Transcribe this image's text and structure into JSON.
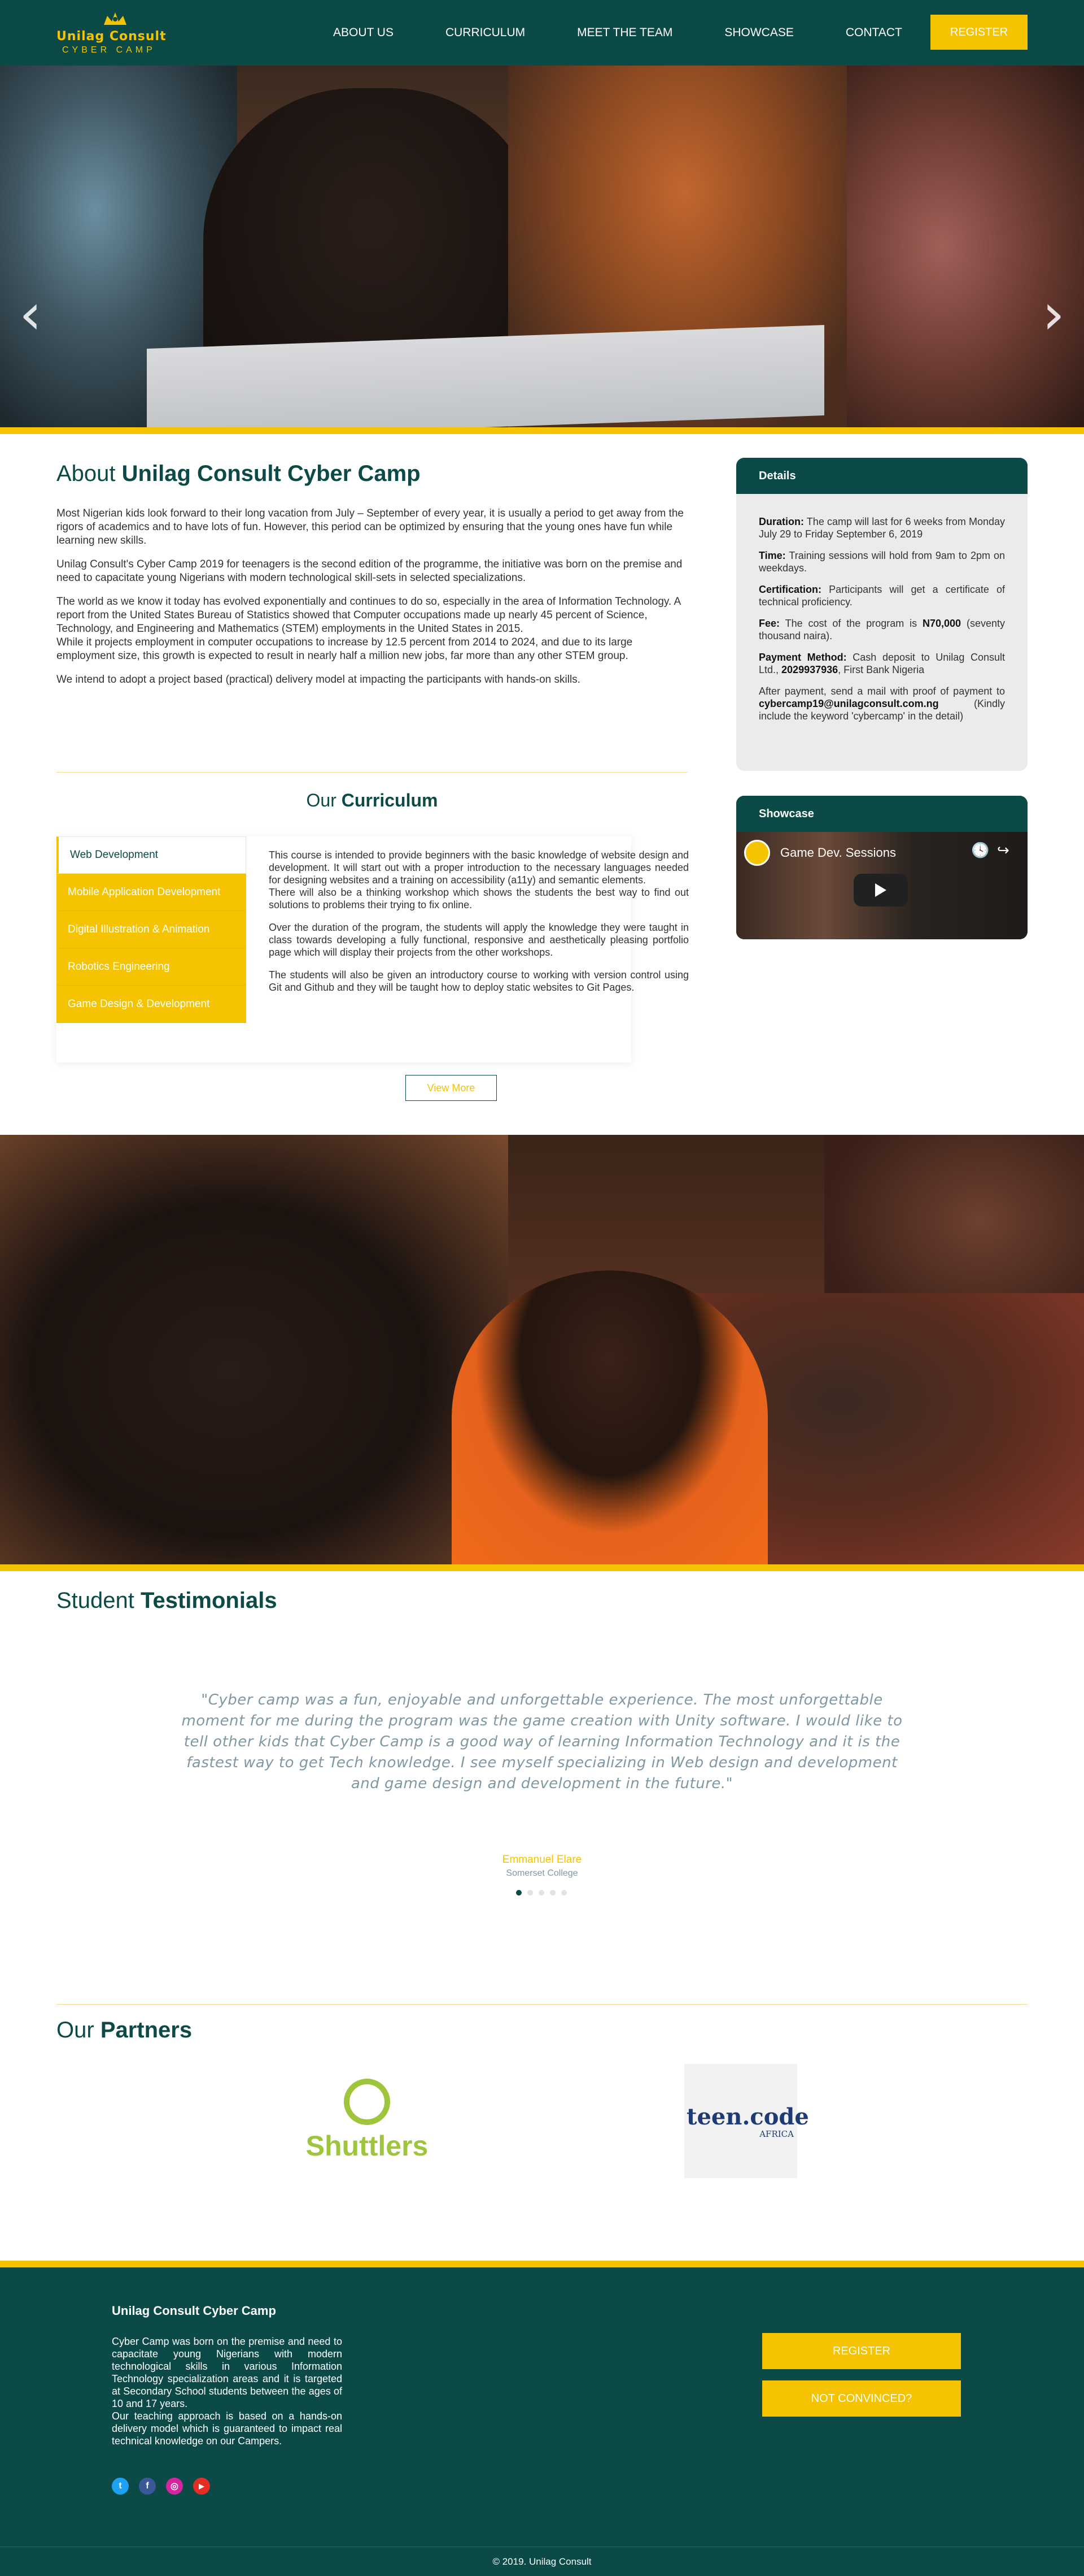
{
  "nav": {
    "logo_line1": "Unilag Consult",
    "logo_line2": "CYBER CAMP",
    "links": [
      "ABOUT US",
      "CURRICULUM",
      "MEET THE TEAM",
      "SHOWCASE",
      "CONTACT"
    ],
    "register": "REGISTER"
  },
  "hero": {
    "prev_arrow": "‹",
    "next_arrow": "›"
  },
  "about": {
    "title_prefix": "About",
    "title_bold": "Unilag Consult Cyber Camp",
    "paragraphs": [
      "Most Nigerian kids look forward to their long vacation from July – September of every year, it is usually a period to get away from the rigors of academics and to have lots of fun. However, this period can be optimized by ensuring that the young ones have fun while learning new skills.",
      "Unilag Consult's Cyber Camp 2019 for teenagers is the second edition of the programme, the initiative was born on the premise and need to capacitate young Nigerians with modern technological skill-sets in selected specializations.",
      "The world as we know it today has evolved exponentially and continues to do so, especially in the area of Information Technology. A report from the United States Bureau of Statistics showed that Computer occupations made up nearly 45 percent of Science, Technology, and Engineering and Mathematics (STEM) employments in the United States in 2015.",
      "While it projects employment in computer occupations to increase by 12.5 percent from 2014 to 2024, and due to its large employment size, this growth is expected to result in nearly half a million new jobs, far more than any other STEM group.",
      "We intend to adopt a project based (practical) delivery model at impacting the participants with hands-on skills."
    ]
  },
  "curriculum": {
    "title_prefix": "Our",
    "title_bold": "Curriculum",
    "tabs": [
      "Web Development",
      "Mobile Application Development",
      "Digital Illustration & Animation",
      "Robotics Engineering",
      "Game Design & Development"
    ],
    "content": [
      "This course is intended to provide beginners with the basic knowledge of website design and development. It will start out with a proper introduction to the necessary languages needed for designing websites and a training on accessibility (a11y) and semantic elements.",
      "There will also be a thinking workshop which shows the students the best way to find out solutions to problems their trying to fix online.",
      "Over the duration of the program, the students will apply the knowledge they were taught in class towards developing a fully functional, responsive and aesthetically pleasing portfolio page which will display their projects from the other workshops.",
      "The students will also be given an introductory course to working with version control using Git and Github and they will be taught how to deploy static websites to Git Pages."
    ],
    "view_more": "View More"
  },
  "details": {
    "title": "Details",
    "duration_label": "Duration:",
    "duration": " The camp will last for 6 weeks from Monday July 29 to Friday September 6, 2019",
    "time_label": "Time:",
    "time": " Training sessions will hold from 9am to 2pm on weekdays.",
    "cert_label": "Certification:",
    "cert": " Participants will get a certificate of technical proficiency.",
    "fee_label": "Fee:",
    "fee_pre": " The cost of the program is ",
    "fee_amount": "N70,000",
    "fee_post": " (seventy thousand naira).",
    "payment_label": "Payment Method:",
    "payment_pre": " Cash deposit to Unilag Consult Ltd., ",
    "payment_account": "2029937936",
    "payment_post": ", First Bank Nigeria",
    "after_pre": "After payment, send a mail with proof of payment to ",
    "after_email": "cybercamp19@unilagconsult.com.ng",
    "after_post": " (Kindly include the keyword 'cybercamp' in the detail)"
  },
  "showcase": {
    "title": "Showcase",
    "video_title": "Game Dev. Sessions",
    "clock_icon": "🕓",
    "share_icon": "↪"
  },
  "testimonials": {
    "title_prefix": "Student",
    "title_bold": "Testimonials",
    "quote": "\"Cyber camp was a fun, enjoyable and unforgettable experience. The most unforgettable moment for me during the program was the game creation with Unity software. I would like to tell other kids that Cyber Camp is a good way of learning Information Technology and it is the fastest way to get Tech knowledge. I see myself specializing in Web design and development and game design and development in the future.\"",
    "author": "Emmanuel Elare",
    "school": "Somerset College",
    "dots": 5,
    "active_dot": 0
  },
  "partners": {
    "title_prefix": "Our",
    "title_bold": "Partners",
    "shuttlers": "Shuttlers",
    "teencode_main": "teen.code",
    "teencode_sub": "AFRICA"
  },
  "footer": {
    "title": "Unilag Consult Cyber Camp",
    "text1": "Cyber Camp was born on the premise and need to capacitate young Nigerians with modern technological skills in various Information Technology specialization areas and it is targeted at Secondary School students between the ages of 10 and 17 years.",
    "text2": "Our teaching approach is based on a hands-on delivery model which is guaranteed to impact real technical knowledge on our Campers.",
    "register": "REGISTER",
    "not_convinced": "NOT CONVINCED?",
    "social": [
      {
        "name": "twitter-icon",
        "glyph": "t",
        "color": "#1da1f2"
      },
      {
        "name": "facebook-icon",
        "glyph": "f",
        "color": "#3b5998"
      },
      {
        "name": "instagram-icon",
        "glyph": "◎",
        "color": "#d6249f"
      },
      {
        "name": "youtube-icon",
        "glyph": "▶",
        "color": "#e52d27"
      }
    ],
    "copyright": "© 2019. Unilag Consult"
  },
  "colors": {
    "primary": "#0c4a47",
    "accent": "#f5c300",
    "muted": "#7f98a4"
  }
}
